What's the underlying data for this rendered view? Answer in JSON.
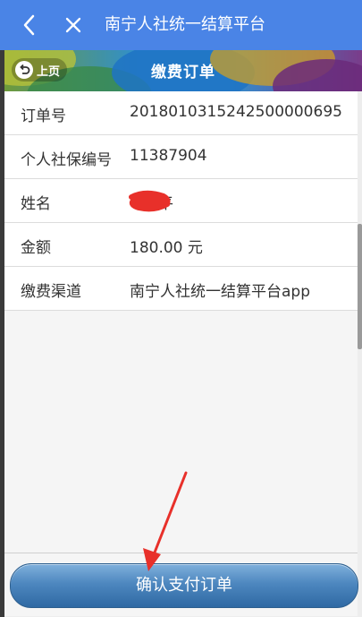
{
  "top_bar": {
    "title": "南宁人社统一结算平台",
    "back_icon": "chevron-left-icon",
    "close_icon": "close-icon",
    "background": "#4a84e6"
  },
  "banner": {
    "prev_label": "上页",
    "prev_icon": "undo-arrow-icon",
    "title": "缴费订单"
  },
  "order": {
    "rows": [
      {
        "label": "订单号",
        "value": "20180103152425000006​95"
      },
      {
        "label": "个人社保编号",
        "value": "11387904"
      },
      {
        "label": "姓名",
        "value": "平"
      },
      {
        "label": "金额",
        "value": "180.00 元"
      },
      {
        "label": "缴费渠道",
        "value": "南宁人社统一结算平台app"
      }
    ]
  },
  "confirm_button": {
    "label": "确认支付订单",
    "color": "#4d87bf"
  },
  "annotation": {
    "arrow_color": "#e8302a",
    "redaction_color": "#e8302a"
  }
}
